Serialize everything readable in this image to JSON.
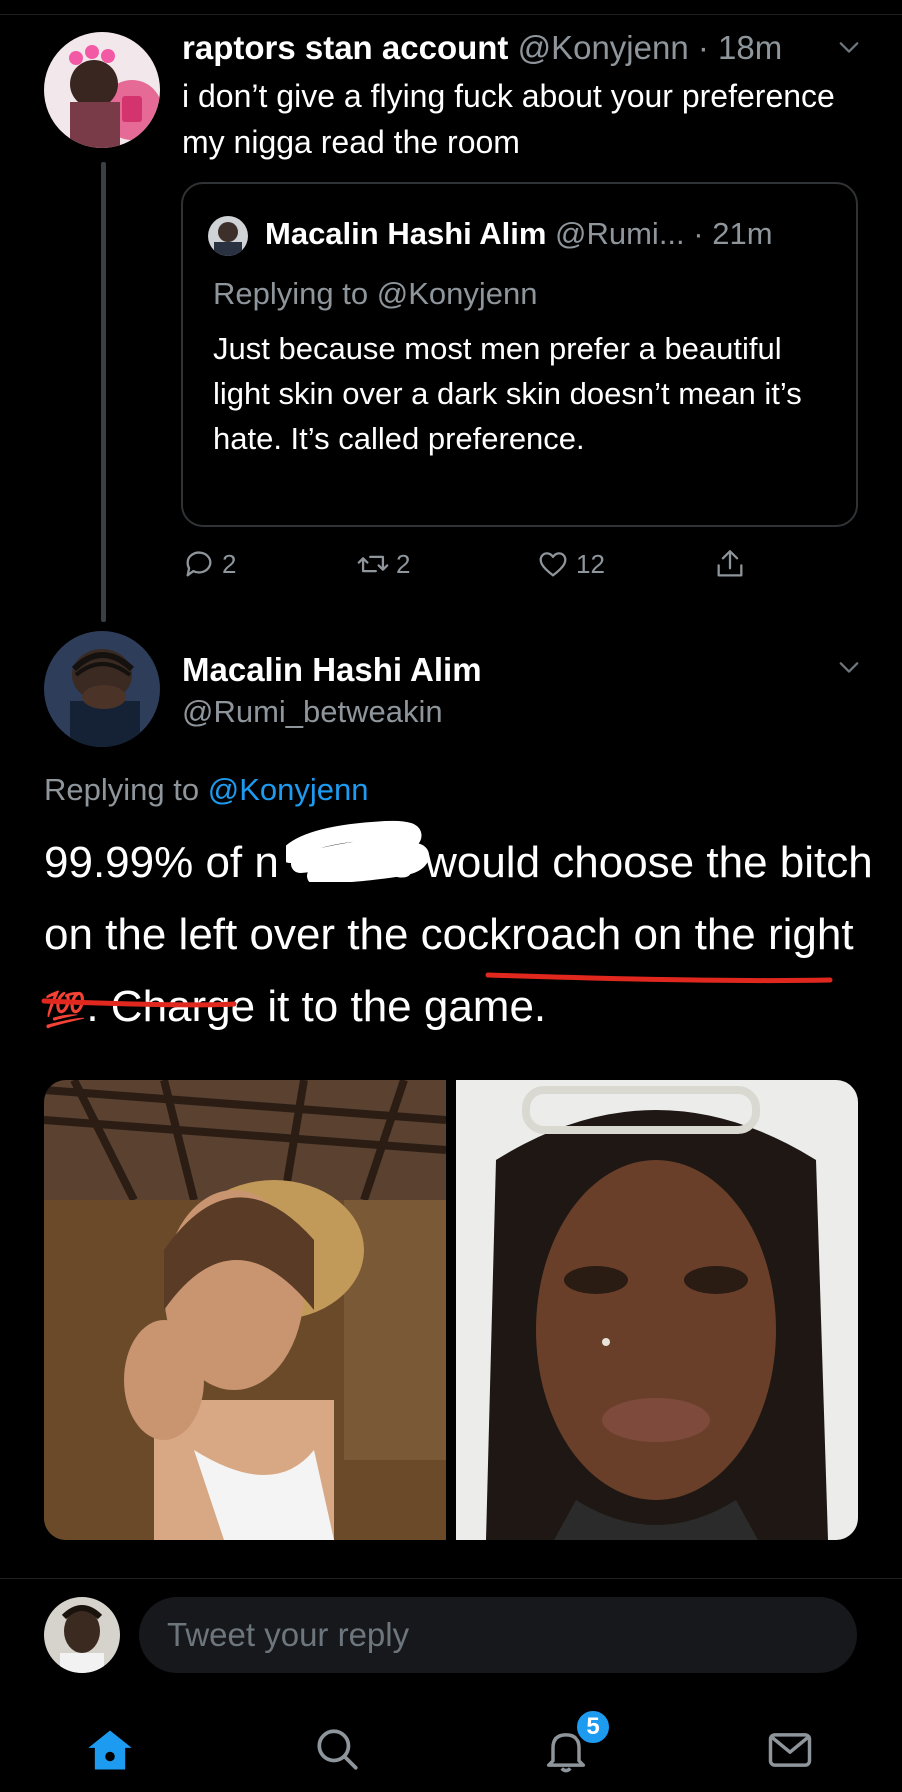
{
  "parent_tweet": {
    "display_name": "raptors stan account",
    "handle": "@Konyjenn",
    "time": "· 18m",
    "text": "i don’t give a flying fuck about your preference my nigga read the room"
  },
  "quoted_tweet": {
    "display_name": "Macalin Hashi Alim",
    "handle": "@Rumi...",
    "time": "· 21m",
    "replying_to_label": "Replying to",
    "replying_to_handle": "@Konyjenn",
    "text": "Just because most men prefer a beautiful light skin over a dark skin doesn’t mean it’s hate. It’s called preference."
  },
  "actions": {
    "reply_count": "2",
    "retweet_count": "2",
    "like_count": "12"
  },
  "main_tweet": {
    "display_name": "Macalin Hashi Alim",
    "handle": "@Rumi_betweakin",
    "replying_to_label": "Replying to",
    "replying_to_handle": "@Konyjenn",
    "text_part1": "99.99% of n",
    "text_part2": "s would choose the bitch on the left over the cockroach on the right",
    "emoji": "💯",
    "text_part3": ". Charge it to the game."
  },
  "compose": {
    "placeholder": "Tweet your reply"
  },
  "tabbar": {
    "notifications_badge": "5"
  },
  "colors": {
    "background": "#000000",
    "accent": "#1d9bf0",
    "muted": "#8e959b",
    "annotation_red": "#e0281e"
  }
}
